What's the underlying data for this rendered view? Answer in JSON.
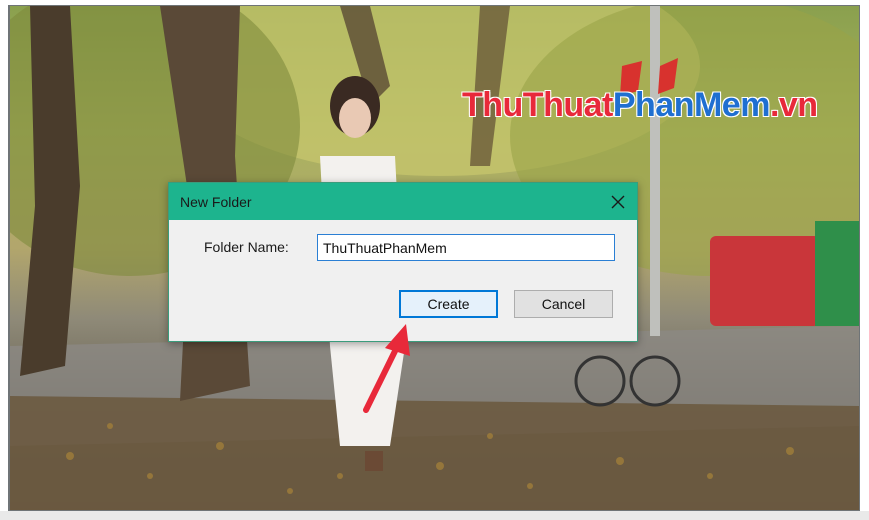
{
  "watermark": {
    "part1": "ThuThuat",
    "part2": "PhanMem",
    "part3": ".vn"
  },
  "dialog": {
    "title": "New Folder",
    "close_icon": "close-icon",
    "folder_name_label": "Folder Name:",
    "folder_name_value": "ThuThuatPhanMem",
    "create_label": "Create",
    "cancel_label": "Cancel"
  },
  "annotation": {
    "icon": "red-arrow-icon",
    "color": "#e8293a"
  },
  "colors": {
    "titlebar": "#1db48e",
    "accent": "#0078d7"
  }
}
